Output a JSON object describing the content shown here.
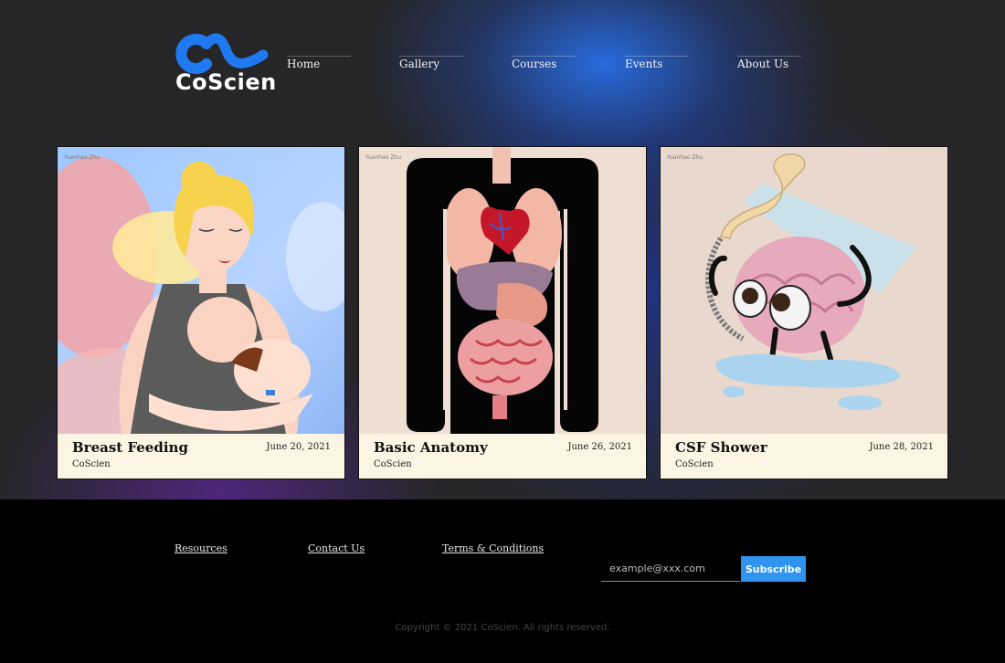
{
  "brand": {
    "name": "CoScien",
    "accent": "#2f93f0"
  },
  "nav": [
    {
      "label": "Home"
    },
    {
      "label": "Gallery"
    },
    {
      "label": "Courses"
    },
    {
      "label": "Events"
    },
    {
      "label": "About Us"
    }
  ],
  "cards": [
    {
      "title": "Breast Feeding",
      "date": "June 20, 2021",
      "author": "CoScien",
      "signature": "Yuanhao Zhu"
    },
    {
      "title": "Basic Anatomy",
      "date": "June 26, 2021",
      "author": "CoScien",
      "signature": "Yuanhao Zhu"
    },
    {
      "title": "CSF Shower",
      "date": "June 28, 2021",
      "author": "CoScien",
      "signature": "Yuanhao Zhu"
    }
  ],
  "footer": {
    "links": [
      {
        "label": "Resources"
      },
      {
        "label": "Contact Us"
      },
      {
        "label": "Terms & Conditions"
      }
    ],
    "email_placeholder": "example@xxx.com",
    "subscribe_label": "Subscribe",
    "copyright": "Copyright © 2021 CoScien. All rights reserved."
  }
}
